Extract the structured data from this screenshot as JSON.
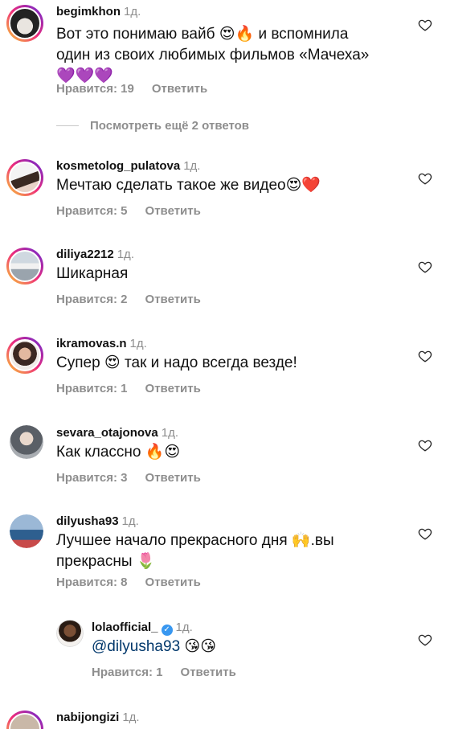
{
  "comments": [
    {
      "username": "begimkhon",
      "time": "1д.",
      "text_line1": "Вот это понимаю вайб 😍🔥 и вспомнила",
      "text_line2": "один из своих любимых фильмов «Мачеха»",
      "text_line3": "💜💜💜",
      "likes": "Нравится: 19",
      "reply": "Ответить"
    },
    {
      "username": "kosmetolog_pulatova",
      "time": "1д.",
      "text_line1": "Мечтаю сделать такое же видео😍❤️",
      "likes": "Нравится: 5",
      "reply": "Ответить"
    },
    {
      "username": "diliya2212",
      "time": "1д.",
      "text_line1": "Шикарная",
      "likes": "Нравится: 2",
      "reply": "Ответить"
    },
    {
      "username": "ikramovas.n",
      "time": "1д.",
      "text_line1": "Супер 😍  так и надо всегда везде!",
      "likes": "Нравится: 1",
      "reply": "Ответить"
    },
    {
      "username": "sevara_otajonova",
      "time": "1д.",
      "text_line1": "Как классно 🔥😍",
      "likes": "Нравится: 3",
      "reply": "Ответить"
    },
    {
      "username": "dilyusha93",
      "time": "1д.",
      "text_line1": "Лучшее начало прекрасного дня 🙌.вы",
      "text_line2": "прекрасны 🌷",
      "likes": "Нравится: 8",
      "reply": "Ответить"
    },
    {
      "username": "lolaofficial_",
      "time": "1д.",
      "mention": "@dilyusha93",
      "text_after": " 😘😘",
      "likes": "Нравится: 1",
      "reply": "Ответить"
    },
    {
      "username": "nabijongizi",
      "time": "1д."
    }
  ],
  "more_replies": "Посмотреть ещё 2 ответов",
  "icons": {
    "like": "heart-outline-icon",
    "verified": "verified-badge-icon"
  },
  "colors": {
    "text": "#111111",
    "secondary": "#8e8e8e",
    "mention": "#00376b",
    "verified": "#3897f0"
  }
}
